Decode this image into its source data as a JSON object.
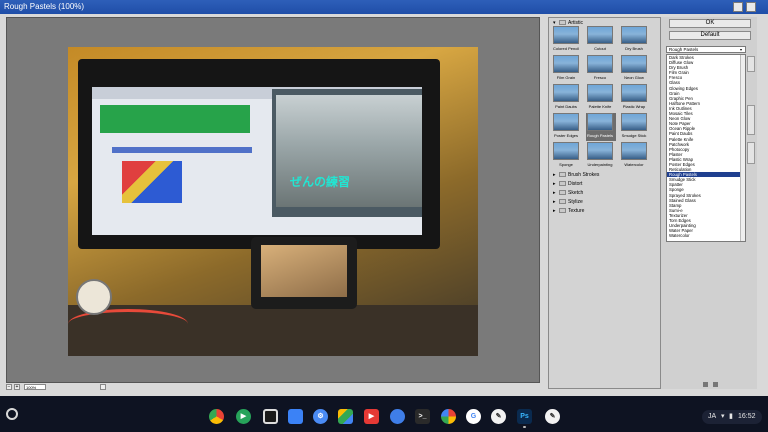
{
  "window": {
    "title": "Rough Pastels (100%)"
  },
  "preview": {
    "zoom_minus": "−",
    "zoom_value": "100%",
    "zoom_plus": "+",
    "photo_caption": "ぜんの練習"
  },
  "gallery": {
    "artistic": {
      "label": "Artistic",
      "expanded_arrow": "▾",
      "filters": [
        "Colored Pencil",
        "Cutout",
        "Dry Brush",
        "Film Grain",
        "Fresco",
        "Neon Glow",
        "Paint Daubs",
        "Palette Knife",
        "Plastic Wrap",
        "Poster Edges",
        "Rough Pastels",
        "Smudge Stick",
        "Sponge",
        "Underpainting",
        "Watercolor"
      ],
      "selected": "Rough Pastels"
    },
    "categories": [
      {
        "label": "Brush Strokes",
        "arrow": "▸"
      },
      {
        "label": "Distort",
        "arrow": "▸"
      },
      {
        "label": "Sketch",
        "arrow": "▸"
      },
      {
        "label": "Stylize",
        "arrow": "▸"
      },
      {
        "label": "Texture",
        "arrow": "▸"
      }
    ]
  },
  "right_panel": {
    "ok_label": "OK",
    "default_label": "Default",
    "filter_select": "Rough Pastels",
    "filter_options": [
      "Dark Strokes",
      "Diffuse Glow",
      "Dry Brush",
      "Film Grain",
      "Fresco",
      "Glass",
      "Glowing Edges",
      "Grain",
      "Graphic Pen",
      "Halftone Pattern",
      "Ink Outlines",
      "Mosaic Tiles",
      "Neon Glow",
      "Note Paper",
      "Ocean Ripple",
      "Paint Daubs",
      "Palette Knife",
      "Patchwork",
      "Photocopy",
      "Plaster",
      "Plastic Wrap",
      "Poster Edges",
      "Reticulation",
      "Rough Pastels",
      "Smudge Stick",
      "Spatter",
      "Sponge",
      "Sprayed Strokes",
      "Stained Glass",
      "Stamp",
      "Sumi-e",
      "Texturizer",
      "Torn Edges",
      "Underpainting",
      "Water Paper",
      "Watercolor"
    ],
    "selected_option": "Rough Pastels"
  },
  "shelf": {
    "apps": [
      "chrome",
      "play-store",
      "files-app",
      "files-folder",
      "settings",
      "drive",
      "youtube",
      "messages",
      "terminal",
      "photos",
      "google-app",
      "pen-app",
      "photoshop",
      "stylus"
    ],
    "photoshop_label": "Ps",
    "terminal_label": ">_",
    "ime": "JA",
    "clock": "16:52"
  },
  "colors": {
    "titlebar": "#1f4ea8",
    "selection": "#1f3f8f",
    "shelf": "#0e1322"
  }
}
